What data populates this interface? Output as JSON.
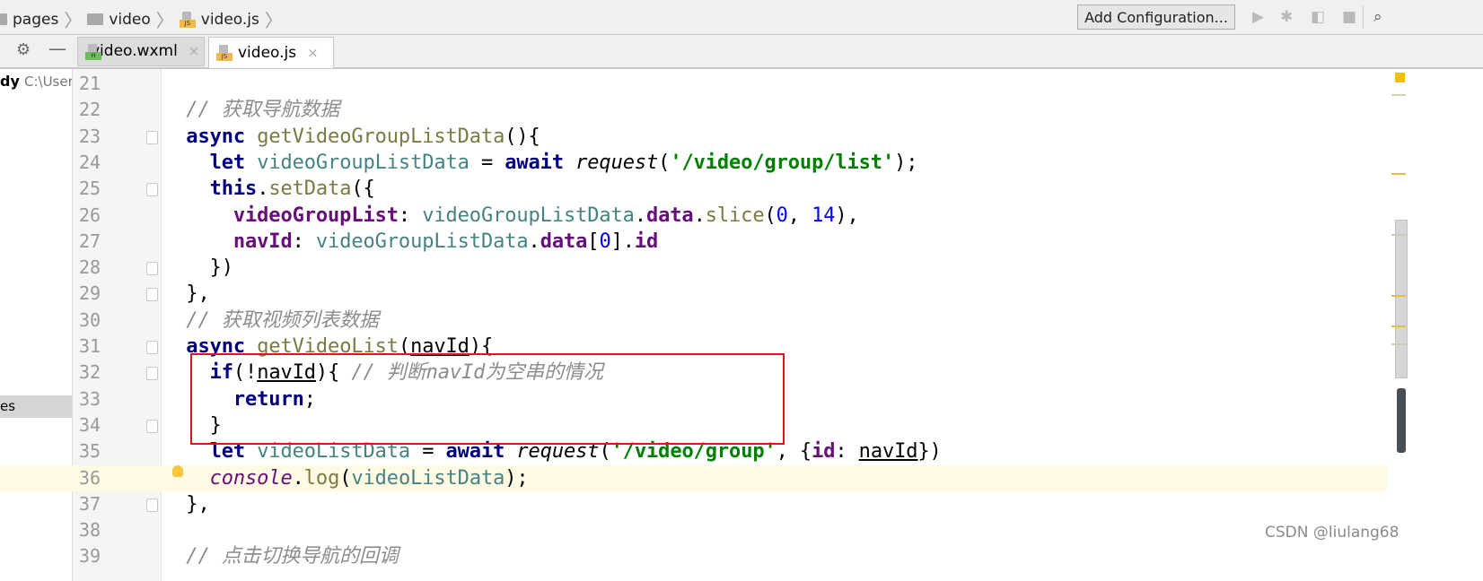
{
  "breadcrumb": [
    {
      "label": "pages",
      "icon": "folder-icon"
    },
    {
      "label": "video",
      "icon": "folder-icon"
    },
    {
      "label": "video.js",
      "icon": "js-file-icon"
    }
  ],
  "toolbar": {
    "add_configuration": "Add Configuration...",
    "icons": [
      "run-icon",
      "debug-icon",
      "coverage-icon",
      "stop-icon",
      "search-icon"
    ]
  },
  "tabs": [
    {
      "label": "video.wxml",
      "icon": "wxml-file-icon",
      "active": false,
      "close": "×"
    },
    {
      "label": "video.js",
      "icon": "js-file-icon",
      "active": true,
      "close": "×"
    }
  ],
  "project_panel": {
    "root_name": "dy",
    "root_path": "C:\\User",
    "selected_item": "es"
  },
  "editor": {
    "current_line": 36,
    "lines": [
      {
        "n": "21",
        "t": []
      },
      {
        "n": "22",
        "t": [
          [
            "  ",
            ""
          ],
          [
            "// 获取导航数据",
            "c"
          ]
        ]
      },
      {
        "n": "23",
        "t": [
          [
            "  ",
            ""
          ],
          [
            "async",
            "k"
          ],
          [
            " ",
            ""
          ],
          [
            "getVideoGroupListData",
            "m"
          ],
          [
            "(){",
            "o"
          ]
        ]
      },
      {
        "n": "24",
        "t": [
          [
            "    ",
            ""
          ],
          [
            "let",
            "k"
          ],
          [
            " ",
            ""
          ],
          [
            "videoGroupListData",
            "v"
          ],
          [
            " = ",
            "o"
          ],
          [
            "await",
            "k"
          ],
          [
            " ",
            ""
          ],
          [
            "request",
            "i"
          ],
          [
            "(",
            "o"
          ],
          [
            "'/video/group/list'",
            "s"
          ],
          [
            ");",
            "o"
          ]
        ]
      },
      {
        "n": "25",
        "t": [
          [
            "    ",
            ""
          ],
          [
            "this",
            "k"
          ],
          [
            ".",
            "o"
          ],
          [
            "setData",
            "m"
          ],
          [
            "({",
            "o"
          ]
        ]
      },
      {
        "n": "26",
        "t": [
          [
            "      ",
            ""
          ],
          [
            "videoGroupList",
            "p"
          ],
          [
            ": ",
            "o"
          ],
          [
            "videoGroupListData",
            "v"
          ],
          [
            ".",
            "o"
          ],
          [
            "data",
            "p"
          ],
          [
            ".",
            "o"
          ],
          [
            "slice",
            "m"
          ],
          [
            "(",
            "o"
          ],
          [
            "0",
            "n"
          ],
          [
            ", ",
            "o"
          ],
          [
            "14",
            "n"
          ],
          [
            "),",
            "o"
          ]
        ]
      },
      {
        "n": "27",
        "t": [
          [
            "      ",
            ""
          ],
          [
            "navId",
            "p"
          ],
          [
            ": ",
            "o"
          ],
          [
            "videoGroupListData",
            "v"
          ],
          [
            ".",
            "o"
          ],
          [
            "data",
            "p"
          ],
          [
            "[",
            "o"
          ],
          [
            "0",
            "n"
          ],
          [
            "].",
            "o"
          ],
          [
            "id",
            "p"
          ]
        ]
      },
      {
        "n": "28",
        "t": [
          [
            "    ",
            ""
          ],
          [
            "})",
            "o"
          ]
        ]
      },
      {
        "n": "29",
        "t": [
          [
            "  ",
            ""
          ],
          [
            "},",
            "o"
          ]
        ]
      },
      {
        "n": "30",
        "t": [
          [
            "  ",
            ""
          ],
          [
            "// 获取视频列表数据",
            "c"
          ]
        ]
      },
      {
        "n": "31",
        "t": [
          [
            "  ",
            ""
          ],
          [
            "async",
            "k"
          ],
          [
            " ",
            ""
          ],
          [
            "getVideoList",
            "m"
          ],
          [
            "(",
            "o"
          ],
          [
            "navId",
            "o u"
          ],
          [
            "){",
            "o"
          ]
        ]
      },
      {
        "n": "32",
        "t": [
          [
            "    ",
            ""
          ],
          [
            "if",
            "k"
          ],
          [
            "(!",
            "o"
          ],
          [
            "navId",
            "o u"
          ],
          [
            "){ ",
            "o"
          ],
          [
            "// 判断navId为空串的情况",
            "c"
          ]
        ]
      },
      {
        "n": "33",
        "t": [
          [
            "      ",
            ""
          ],
          [
            "return",
            "k"
          ],
          [
            ";",
            "o"
          ]
        ]
      },
      {
        "n": "34",
        "t": [
          [
            "    ",
            ""
          ],
          [
            "}",
            "o"
          ]
        ]
      },
      {
        "n": "35",
        "t": [
          [
            "    ",
            ""
          ],
          [
            "let",
            "k"
          ],
          [
            " ",
            ""
          ],
          [
            "videoListData",
            "v"
          ],
          [
            " = ",
            "o"
          ],
          [
            "await",
            "k"
          ],
          [
            " ",
            ""
          ],
          [
            "request",
            "i"
          ],
          [
            "(",
            "o"
          ],
          [
            "'/video/group'",
            "s"
          ],
          [
            ", {",
            "o"
          ],
          [
            "id",
            "p"
          ],
          [
            ": ",
            "o"
          ],
          [
            "navId",
            "o u"
          ],
          [
            "})",
            "o"
          ]
        ]
      },
      {
        "n": "36",
        "t": [
          [
            "    ",
            ""
          ],
          [
            "console",
            "ci"
          ],
          [
            ".",
            "o"
          ],
          [
            "log",
            "m"
          ],
          [
            "(",
            "o"
          ],
          [
            "videoListData",
            "v"
          ],
          [
            ");",
            "o"
          ]
        ]
      },
      {
        "n": "37",
        "t": [
          [
            "  ",
            ""
          ],
          [
            "},",
            "o"
          ]
        ]
      },
      {
        "n": "38",
        "t": []
      },
      {
        "n": "39",
        "t": [
          [
            "  ",
            ""
          ],
          [
            "// 点击切换导航的回调",
            "c"
          ]
        ]
      }
    ]
  },
  "colors": {
    "keyword": "#000080",
    "string": "#008000",
    "comment": "#8c8c8c",
    "property": "#660e7a",
    "number": "#0000ff",
    "highlight_box": "#e0141e",
    "current_line": "#fffae3"
  },
  "watermark": "CSDN @liulang68"
}
